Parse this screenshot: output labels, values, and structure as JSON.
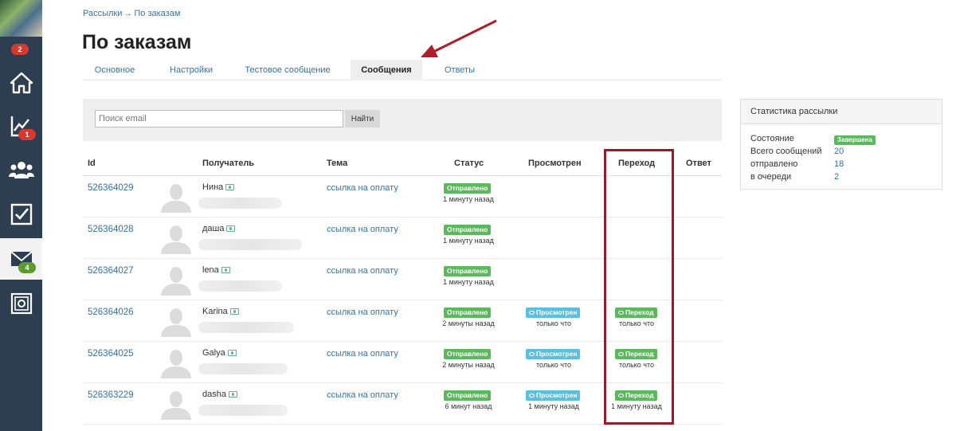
{
  "sidebar": {
    "badges": {
      "top": "2",
      "stats": "1",
      "mail": "4"
    },
    "icons": [
      "home-icon",
      "chart-icon",
      "users-icon",
      "checkbox-icon",
      "mail-icon",
      "settings-box-icon"
    ]
  },
  "breadcrumb": {
    "parent": "Рассылки",
    "separator": "→",
    "current": "По заказам"
  },
  "title": "По заказам",
  "tabs": [
    "Основное",
    "Настройки",
    "Тестовое сообщение",
    "Сообщения",
    "Ответы"
  ],
  "active_tab": "Сообщения",
  "search": {
    "placeholder": "Поиск email",
    "button": "Найти"
  },
  "table": {
    "headers": {
      "id": "Id",
      "recipient": "Получатель",
      "topic": "Тема",
      "status": "Статус",
      "viewed": "Просмотрен",
      "click": "Переход",
      "reply": "Ответ"
    },
    "rows": [
      {
        "id": "526364029",
        "name": "Нина",
        "topic": "ссылка на оплату",
        "status": "Отправлено",
        "status_time": "1 минуту назад",
        "viewed": "",
        "viewed_time": "",
        "click": "",
        "click_time": ""
      },
      {
        "id": "526364028",
        "name": "даша",
        "topic": "ссылка на оплату",
        "status": "Отправлено",
        "status_time": "1 минуту назад",
        "viewed": "",
        "viewed_time": "",
        "click": "",
        "click_time": ""
      },
      {
        "id": "526364027",
        "name": "lena",
        "topic": "ссылка на оплату",
        "status": "Отправлено",
        "status_time": "1 минуту назад",
        "viewed": "",
        "viewed_time": "",
        "click": "",
        "click_time": ""
      },
      {
        "id": "526364026",
        "name": "Karina",
        "topic": "ссылка на оплату",
        "status": "Отправлено",
        "status_time": "2 минуты назад",
        "viewed": "Просмотрен",
        "viewed_time": "только что",
        "click": "Переход",
        "click_time": "только что"
      },
      {
        "id": "526364025",
        "name": "Galya",
        "topic": "ссылка на оплату",
        "status": "Отправлено",
        "status_time": "2 минуты назад",
        "viewed": "Просмотрен",
        "viewed_time": "только что",
        "click": "Переход",
        "click_time": "только что"
      },
      {
        "id": "526363229",
        "name": "dasha",
        "topic": "ссылка на оплату",
        "status": "Отправлено",
        "status_time": "6 минут назад",
        "viewed": "Просмотрен",
        "viewed_time": "1 минуту назад",
        "click": "Переход",
        "click_time": "1 минуту назад"
      }
    ]
  },
  "stats": {
    "title": "Статистика рассылки",
    "state_label": "Состояние",
    "state_value": "Завершена",
    "total_label": "Всего сообщений",
    "total_value": "20",
    "sent_label": "отправлено",
    "sent_value": "18",
    "queue_label": "в очереди",
    "queue_value": "2"
  },
  "colors": {
    "sidebar": "#2d3e50",
    "link": "#3572a5",
    "success": "#5cb85c",
    "info": "#5bc0de",
    "highlight": "#9b1b28"
  }
}
